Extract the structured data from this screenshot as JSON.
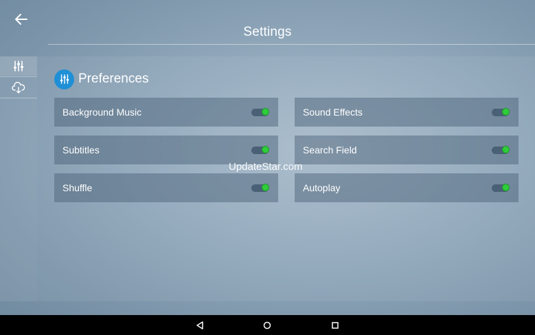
{
  "header": {
    "title": "Settings",
    "back_icon": "arrow-left-icon"
  },
  "sidebar": {
    "items": [
      {
        "icon": "sliders-icon",
        "active": true
      },
      {
        "icon": "cloud-download-icon",
        "active": false
      }
    ]
  },
  "section": {
    "title": "Preferences",
    "icon": "sliders-icon",
    "accent": "#1f8fd6"
  },
  "settings": [
    {
      "label": "Background Music",
      "enabled": true
    },
    {
      "label": "Sound Effects",
      "enabled": true
    },
    {
      "label": "Subtitles",
      "enabled": true
    },
    {
      "label": "Search Field",
      "enabled": true
    },
    {
      "label": "Shuffle",
      "enabled": true
    },
    {
      "label": "Autoplay",
      "enabled": true
    }
  ],
  "watermark": "UpdateStar.com",
  "navbar": {
    "back": "nav-back-icon",
    "home": "nav-home-icon",
    "recents": "nav-recents-icon"
  },
  "colors": {
    "toggle_on": "#2fcc3b"
  }
}
